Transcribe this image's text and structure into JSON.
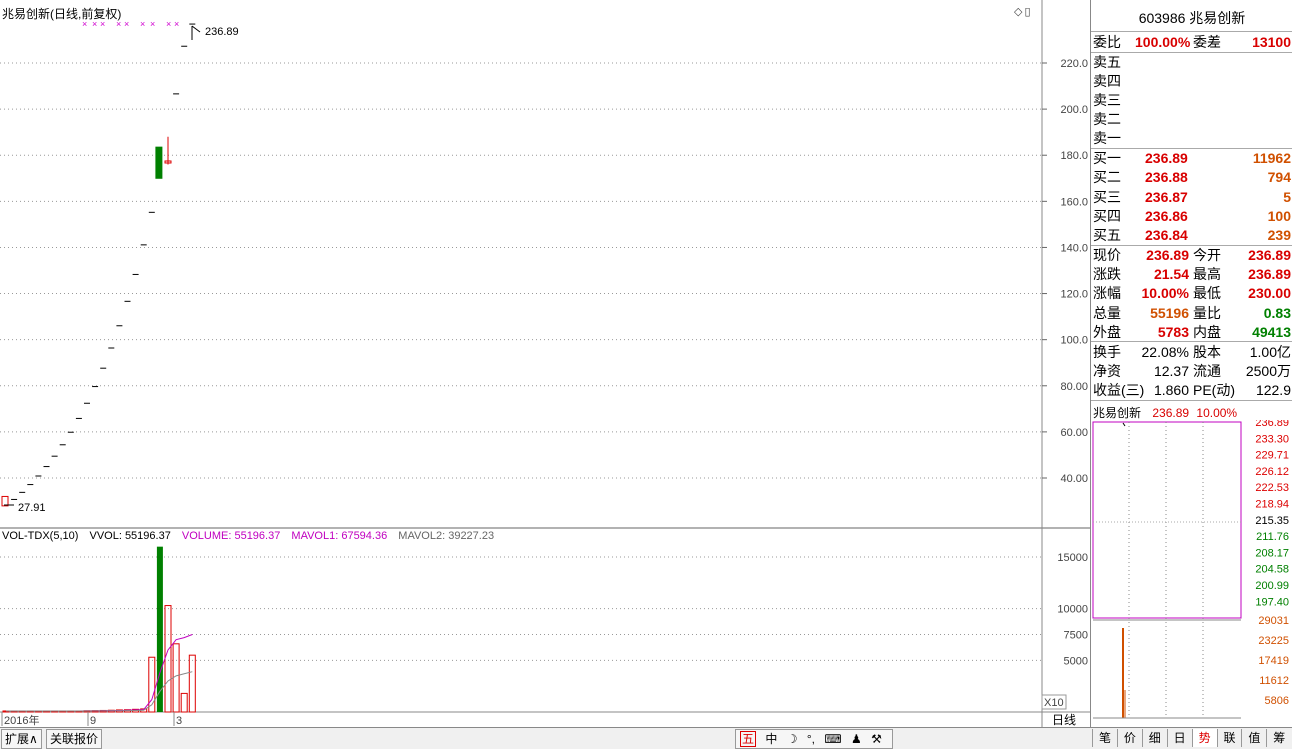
{
  "chart_title": "兆易创新(日线,前复权)",
  "top_icons": "◇▯",
  "price_labels": {
    "high": "236.89",
    "low": "27.91"
  },
  "y_axis": [
    "220.0",
    "200.0",
    "180.0",
    "160.0",
    "140.0",
    "120.0",
    "100.0",
    "80.00",
    "60.00",
    "40.00"
  ],
  "vol_header": {
    "name": "VOL-TDX(5,10)",
    "vvol": "VVOL: 55196.37",
    "volume": "VOLUME: 55196.37",
    "mavol1": "MAVOL1: 67594.36",
    "mavol2": "MAVOL2: 39227.23"
  },
  "vol_axis": [
    "15000",
    "10000",
    "7500",
    "5000"
  ],
  "vol_axis_unit": "X10",
  "x_axis": [
    "2016年",
    "9",
    "3"
  ],
  "period_label": "日线",
  "chart_data": {
    "type": "candlestick",
    "title": "兆易创新(日线,前复权)",
    "ylim": [
      27.91,
      236.89
    ],
    "closes": [
      27.91,
      30.7,
      33.77,
      37.15,
      40.87,
      44.96,
      49.46,
      54.41,
      59.85,
      65.84,
      72.42,
      79.66,
      87.63,
      96.39,
      106.03,
      116.63,
      128.29,
      141.12,
      155.23,
      170.75,
      187.83,
      206.61,
      227.27,
      236.89
    ],
    "volume": {
      "ylim": [
        0,
        16000
      ],
      "ticks": [
        5000,
        7500,
        10000,
        15000
      ],
      "mavol1": "67594.36",
      "mavol2": "39227.23",
      "last": "55196.37"
    }
  },
  "right_panel": {
    "code_name": "603986 兆易创新",
    "weibi_label": "委比",
    "weibi": "100.00%",
    "weicha_label": "委差",
    "weicha": "13100",
    "sell": [
      {
        "label": "卖五",
        "price": "",
        "vol": ""
      },
      {
        "label": "卖四",
        "price": "",
        "vol": ""
      },
      {
        "label": "卖三",
        "price": "",
        "vol": ""
      },
      {
        "label": "卖二",
        "price": "",
        "vol": ""
      },
      {
        "label": "卖一",
        "price": "",
        "vol": ""
      }
    ],
    "buy": [
      {
        "label": "买一",
        "price": "236.89",
        "vol": "11962"
      },
      {
        "label": "买二",
        "price": "236.88",
        "vol": "794"
      },
      {
        "label": "买三",
        "price": "236.87",
        "vol": "5"
      },
      {
        "label": "买四",
        "price": "236.86",
        "vol": "100"
      },
      {
        "label": "买五",
        "price": "236.84",
        "vol": "239"
      }
    ],
    "stats": [
      {
        "l1": "现价",
        "v1": "236.89",
        "c1": "red",
        "l2": "今开",
        "v2": "236.89",
        "c2": "red"
      },
      {
        "l1": "涨跌",
        "v1": "21.54",
        "c1": "red",
        "l2": "最高",
        "v2": "236.89",
        "c2": "red"
      },
      {
        "l1": "涨幅",
        "v1": "10.00%",
        "c1": "red",
        "l2": "最低",
        "v2": "230.00",
        "c2": "red"
      },
      {
        "l1": "总量",
        "v1": "55196",
        "c1": "orange",
        "l2": "量比",
        "v2": "0.83",
        "c2": "green"
      },
      {
        "l1": "外盘",
        "v1": "5783",
        "c1": "red",
        "l2": "内盘",
        "v2": "49413",
        "c2": "green"
      }
    ],
    "stats2": [
      {
        "l1": "换手",
        "v1": "22.08%",
        "l2": "股本",
        "v2": "1.00亿"
      },
      {
        "l1": "净资",
        "v1": "12.37",
        "l2": "流通",
        "v2": "2500万"
      },
      {
        "l1": "收益(三)",
        "v1": "1.860",
        "l2": "PE(动)",
        "v2": "122.9"
      }
    ],
    "mini_title": {
      "name": "兆易创新",
      "price": "236.89",
      "pct": "10.00%"
    },
    "mini_prices": [
      "236.89",
      "233.30",
      "229.71",
      "226.12",
      "222.53",
      "218.94",
      "215.35",
      "211.76",
      "208.17",
      "204.58",
      "200.99",
      "197.40"
    ],
    "mini_vols": [
      "29031",
      "23225",
      "17419",
      "11612",
      "5806"
    ]
  },
  "bottom_tabs": [
    "扩展∧",
    "关联报价"
  ],
  "tool_strip": [
    "五",
    "中",
    "☽",
    "°,",
    "⌨",
    "♟",
    "⚒"
  ],
  "right_tabs": [
    "笔",
    "价",
    "细",
    "日",
    "势",
    "联",
    "值",
    "筹"
  ]
}
